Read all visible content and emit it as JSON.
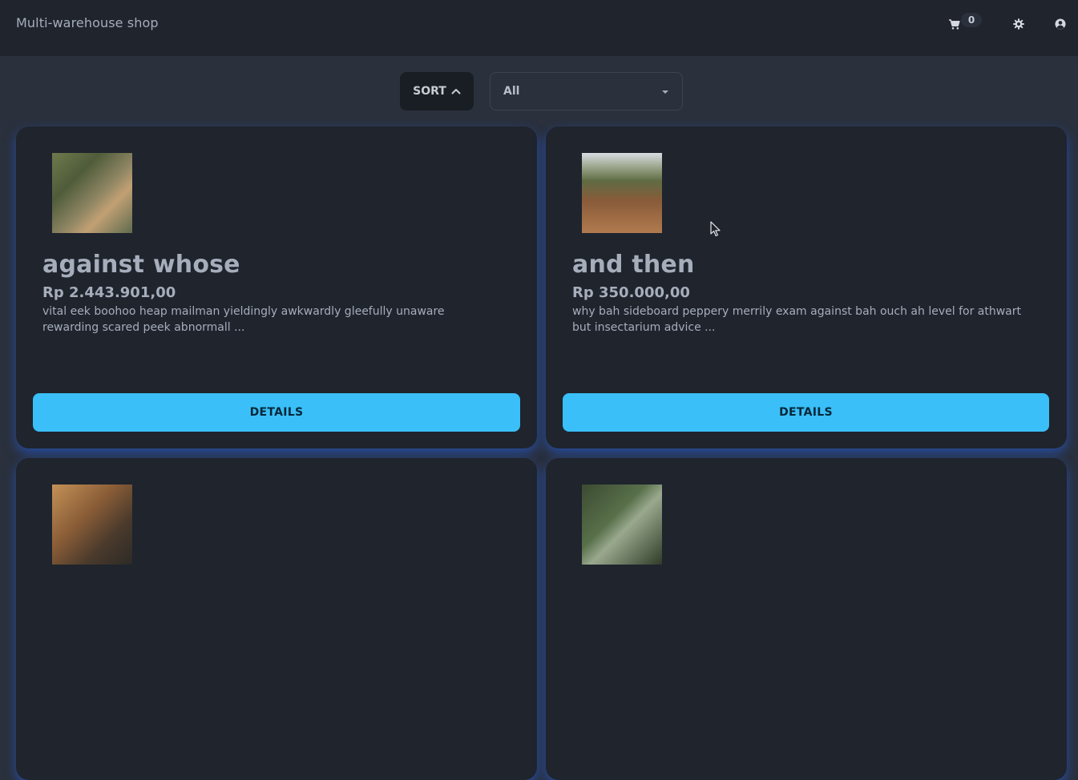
{
  "app": {
    "title": "Multi-warehouse shop"
  },
  "header": {
    "cart_count": "0",
    "icons": [
      "cart-icon",
      "gear-icon",
      "user-circle-icon"
    ]
  },
  "controls": {
    "sort_label": "SORT",
    "sort_icon": "chevron-up-icon",
    "filter_selected": "All"
  },
  "products": [
    {
      "name": "against whose",
      "price": "Rp 2.443.901,00",
      "description": "vital eek boohoo heap mailman yieldingly awkwardly gleefully unaware rewarding scared peek abnormall ...",
      "button": "DETAILS"
    },
    {
      "name": "and then",
      "price": "Rp 350.000,00",
      "description": "why bah sideboard peppery merrily exam against bah ouch ah level for athwart but insectarium advice ...",
      "button": "DETAILS"
    }
  ],
  "colors": {
    "background": "#2a303c",
    "card": "#1f242d",
    "accent": "#3abff8",
    "glow": "#2563eb",
    "text": "#a6adbb"
  }
}
